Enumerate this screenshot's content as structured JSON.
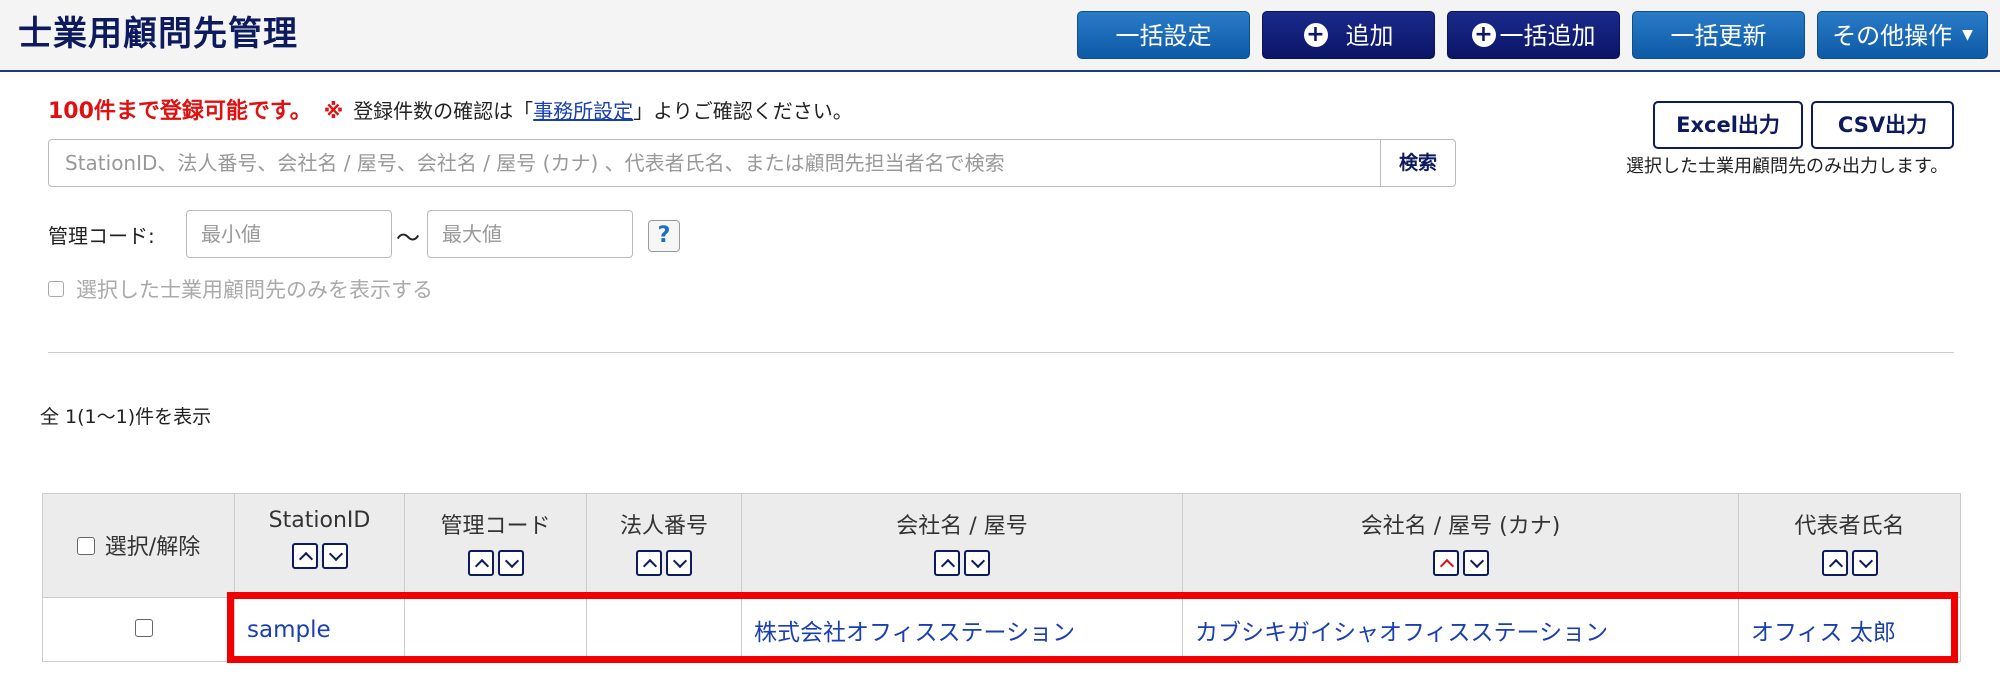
{
  "header": {
    "title": "士業用顧問先管理",
    "buttons": {
      "bulk_settings": "一括設定",
      "add": "追加",
      "bulk_add": "一括追加",
      "bulk_update": "一括更新",
      "other_actions": "その他操作"
    }
  },
  "notice": {
    "limit_text": "100件まで登録可能です。",
    "mark": "※",
    "prefix": "登録件数の確認は「",
    "link_text": "事務所設定",
    "suffix": "」よりご確認ください。"
  },
  "search": {
    "placeholder": "StationID、法人番号、会社名 / 屋号、会社名 / 屋号 (カナ) 、代表者氏名、または顧問先担当者名で検索",
    "button": "検索"
  },
  "export": {
    "excel": "Excel出力",
    "csv": "CSV出力",
    "note": "選択した士業用顧問先のみ出力します。"
  },
  "code_filter": {
    "label": "管理コード:",
    "min_placeholder": "最小値",
    "tilde": "〜",
    "max_placeholder": "最大値",
    "help": "?"
  },
  "filter_selected": {
    "label": "選択した士業用顧問先のみを表示する"
  },
  "count_text": "全 1(1〜1)件を表示",
  "table": {
    "select_header": "選択/解除",
    "columns": [
      "StationID",
      "管理コード",
      "法人番号",
      "会社名 / 屋号",
      "会社名 / 屋号 (カナ)",
      "代表者氏名"
    ],
    "rows": [
      {
        "station_id": "sample",
        "management_code": "",
        "corporate_number": "",
        "company_name": "株式会社オフィスステーション",
        "company_name_kana": "カブシキガイシャオフィスステーション",
        "representative": "オフィス 太郎"
      }
    ]
  },
  "colors": {
    "primary_dark": "#0d1b5e",
    "button_blue": "#0d5aa6",
    "link": "#1a3fb0",
    "alert_red": "#e01010",
    "highlight": "#f00000"
  }
}
